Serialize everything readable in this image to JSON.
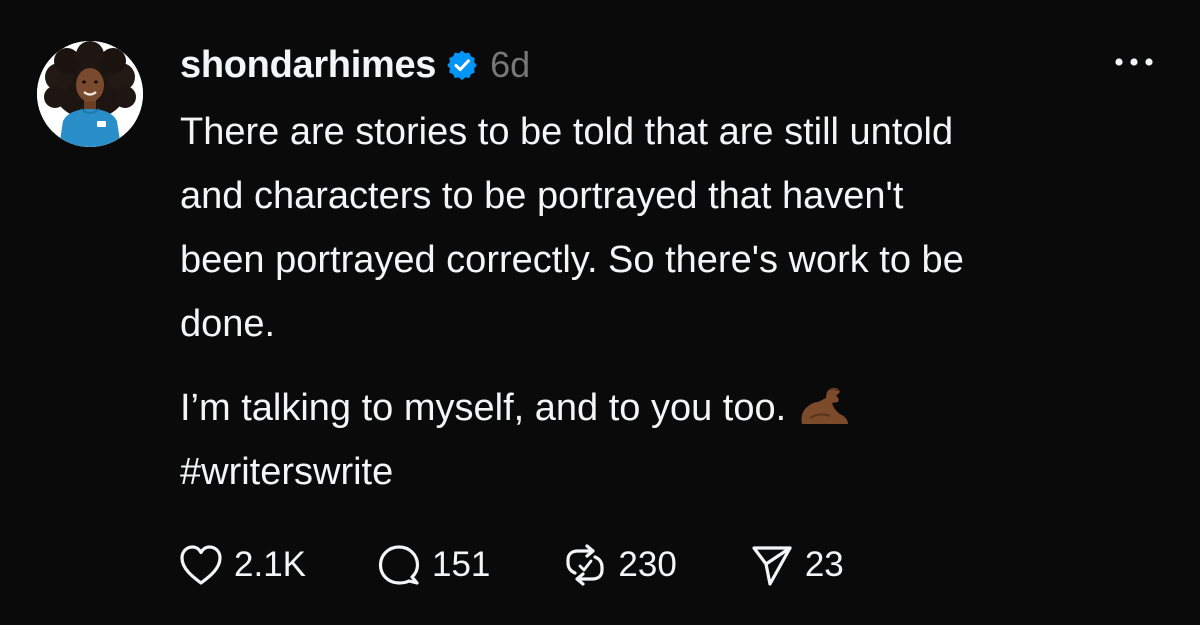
{
  "post": {
    "username": "shondarhimes",
    "time": "6d",
    "paragraph1_lines": [
      "There are stories to be told that are still untold",
      "and characters to be portrayed that haven't",
      "been portrayed correctly. So there's work to be",
      "done."
    ],
    "paragraph2_text": "I’m talking to myself, and to you too.",
    "hashtag": "#writerswrite",
    "emoji": "flexed-biceps-medium-dark-skin-tone"
  },
  "actions": {
    "likes": "2.1K",
    "replies": "151",
    "reposts": "230",
    "shares": "23"
  },
  "colors": {
    "background": "#0a0a0a",
    "text": "#f3f5f7",
    "muted": "#777777",
    "verified": "#0095f6"
  }
}
